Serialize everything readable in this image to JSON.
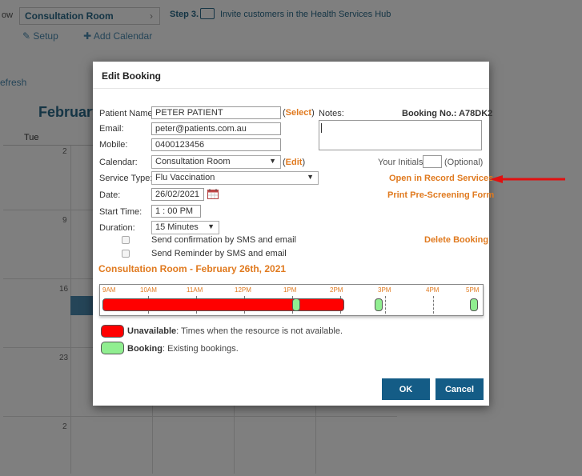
{
  "background": {
    "view_label": "ow",
    "calendar_select": "Consultation Room",
    "step_label": "Step 3.",
    "step_text": "Invite customers in the Health Services Hub",
    "setup_link": "Setup",
    "add_calendar_link": "Add Calendar",
    "refresh_link": "efresh",
    "month_label": "February",
    "day_header": "Tue",
    "day_numbers": [
      "2",
      "9",
      "16",
      "23",
      "2"
    ]
  },
  "modal": {
    "title": "Edit Booking",
    "patient_name_label": "Patient Name:",
    "patient_name_value": "PETER PATIENT",
    "select_link": "Select",
    "notes_label": "Notes:",
    "booking_no": "Booking No.: A78DK2",
    "email_label": "Email:",
    "email_value": "peter@patients.com.au",
    "mobile_label": "Mobile:",
    "mobile_value": "0400123456",
    "calendar_label": "Calendar:",
    "calendar_value": "Consultation Room",
    "edit_link": "Edit",
    "initials_label": "Your Initials:",
    "initials_value": "",
    "optional_label": "(Optional)",
    "service_type_label": "Service Type:",
    "service_type_value": "Flu Vaccination",
    "open_record_link": "Open in Record Services",
    "date_label": "Date:",
    "date_value": "26/02/2021",
    "print_link": "Print Pre-Screening Form",
    "start_time_label": "Start Time:",
    "start_time_value": "1 : 00 PM",
    "duration_label": "Duration:",
    "duration_value": "15 Minutes",
    "send_confirmation_label": "Send confirmation by SMS and email",
    "send_reminder_label": "Send Reminder by SMS and email",
    "delete_link": "Delete Booking",
    "section_heading": "Consultation Room - February 26th, 2021",
    "timeline_hours": [
      "9AM",
      "10AM",
      "11AM",
      "12PM",
      "1PM",
      "2PM",
      "3PM",
      "4PM",
      "5PM"
    ],
    "legend_unavailable_title": "Unavailable",
    "legend_unavailable_text": ": Times when the resource is not available.",
    "legend_booking_title": "Booking",
    "legend_booking_text": ": Existing bookings.",
    "ok_label": "OK",
    "cancel_label": "Cancel"
  },
  "colors": {
    "accent_orange": "#e07a1f",
    "button_blue": "#145c86",
    "unavailable": "#ff0000",
    "booking": "#90ee90",
    "annotation_arrow": "#e01010"
  }
}
